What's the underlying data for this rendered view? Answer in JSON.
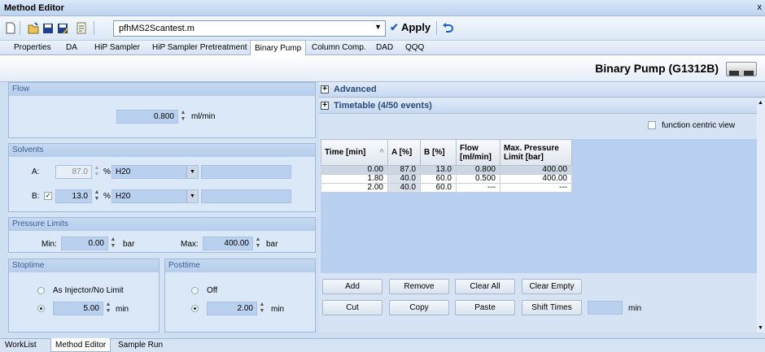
{
  "window": {
    "title": "Method Editor",
    "close": "x"
  },
  "toolbar": {
    "method_name": "pfhMS2Scantest.m",
    "apply_label": "Apply",
    "icons": [
      "new-icon",
      "open-icon",
      "save-icon",
      "save-as-icon",
      "audit-icon",
      "undo-icon"
    ]
  },
  "tabs": [
    "Properties",
    "DA",
    "HiP Sampler",
    "HiP Sampler Pretreatment",
    "Binary Pump",
    "Column Comp.",
    "DAD",
    "QQQ"
  ],
  "active_tab": "Binary Pump",
  "header": {
    "title": "Binary Pump (G1312B)"
  },
  "flow": {
    "title": "Flow",
    "value": "0.800",
    "unit": "ml/min"
  },
  "solvents": {
    "title": "Solvents",
    "a_label": "A:",
    "a_value": "87.0",
    "a_pct": "%",
    "a_solvent": "H20",
    "b_label": "B:",
    "b_value": "13.0",
    "b_pct": "%",
    "b_solvent": "H20",
    "b_checked": true
  },
  "pressure": {
    "title": "Pressure Limits",
    "min_label": "Min:",
    "min_value": "0.00",
    "max_label": "Max:",
    "max_value": "400.00",
    "unit": "bar"
  },
  "stoptime": {
    "title": "Stoptime",
    "option1": "As Injector/No Limit",
    "value": "5.00",
    "unit": "min"
  },
  "posttime": {
    "title": "Posttime",
    "option1": "Off",
    "value": "2.00",
    "unit": "min"
  },
  "advanced": {
    "label": "Advanced"
  },
  "timetable": {
    "label": "Timetable (4/50 events)",
    "function_centric": "function centric view",
    "columns": [
      "Time [min]",
      "A [%]",
      "B [%]",
      "Flow [ml/min]",
      "Max. Pressure Limit [bar]"
    ],
    "rows": [
      [
        "0.00",
        "87.0",
        "13.0",
        "0.800",
        "400.00"
      ],
      [
        "1.80",
        "40.0",
        "60.0",
        "0.500",
        "400.00"
      ],
      [
        "2.00",
        "40.0",
        "60.0",
        "---",
        "---"
      ]
    ]
  },
  "buttons": {
    "add": "Add",
    "remove": "Remove",
    "clear_all": "Clear All",
    "clear_empty": "Clear Empty",
    "cut": "Cut",
    "copy": "Copy",
    "paste": "Paste",
    "shift_times": "Shift Times",
    "shift_unit": "min"
  },
  "bottom_tabs": [
    "WorkList",
    "Method Editor",
    "Sample Run"
  ],
  "active_bottom_tab": "Method Editor"
}
